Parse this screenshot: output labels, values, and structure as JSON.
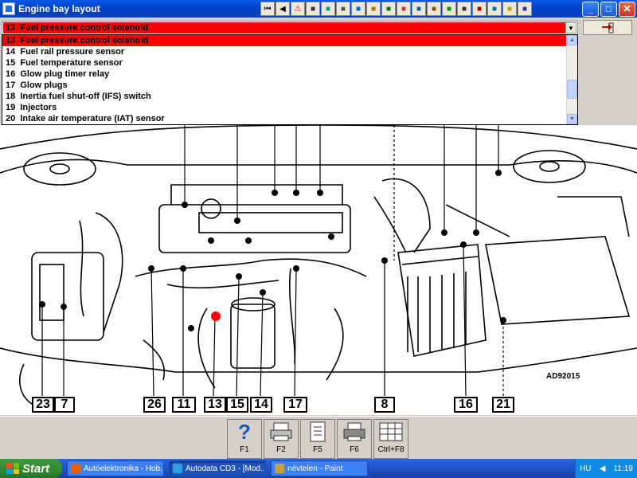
{
  "window": {
    "title": "Engine bay layout"
  },
  "toolbar": {
    "buttons": [
      {
        "icon": "first-page-icon"
      },
      {
        "icon": "previous-icon"
      },
      {
        "icon": "warning-icon"
      },
      {
        "icon": "notebook-icon"
      },
      {
        "icon": "diagram-icon"
      },
      {
        "icon": "tools-icon"
      },
      {
        "icon": "gauge-icon"
      },
      {
        "icon": "mechanic-icon"
      },
      {
        "icon": "adjust-icon"
      },
      {
        "icon": "book-icon"
      },
      {
        "icon": "service-icon"
      },
      {
        "icon": "oil-icon"
      },
      {
        "icon": "battery-icon"
      },
      {
        "icon": "tyre-icon"
      },
      {
        "icon": "brake-icon"
      },
      {
        "icon": "parts-icon"
      },
      {
        "icon": "lamp-icon"
      },
      {
        "icon": "car-icon"
      }
    ],
    "window_controls": {
      "minimize": "_",
      "maximize": "□",
      "close": "✕"
    }
  },
  "component_select": {
    "selected": "13  Fuel pressure control solenoid",
    "options": [
      "13  Fuel pressure control solenoid",
      "14  Fuel rail pressure sensor",
      "15  Fuel temperature sensor",
      "16  Glow plug timer relay",
      "17  Glow plugs",
      "18  Inertia fuel shut-off (IFS) switch",
      "19  Injectors",
      "20  Intake air temperature (IAT) sensor"
    ]
  },
  "diagram": {
    "code": "AD92015",
    "callouts": [
      "23",
      "7",
      "26",
      "11",
      "13",
      "15",
      "14",
      "17",
      "8",
      "16",
      "21"
    ],
    "colors": {
      "highlight": "#ff0000",
      "selection": "#ff0000"
    }
  },
  "function_keys": [
    {
      "label": "F1",
      "icon": "help-icon"
    },
    {
      "label": "F2",
      "icon": "print-icon"
    },
    {
      "label": "F5",
      "icon": "notes-icon"
    },
    {
      "label": "F6",
      "icon": "printer-icon"
    },
    {
      "label": "Ctrl+F8",
      "icon": "table-icon"
    }
  ],
  "taskbar": {
    "start": "Start",
    "tasks": [
      {
        "label": "Autóelektronika - Hob...",
        "icon": "firefox-icon"
      },
      {
        "label": "Autodata CD3 - [Mod...",
        "icon": "autodata-icon",
        "active": true
      },
      {
        "label": "névtelen - Paint",
        "icon": "paint-icon"
      }
    ],
    "language": "HU",
    "clock": "11:19"
  }
}
